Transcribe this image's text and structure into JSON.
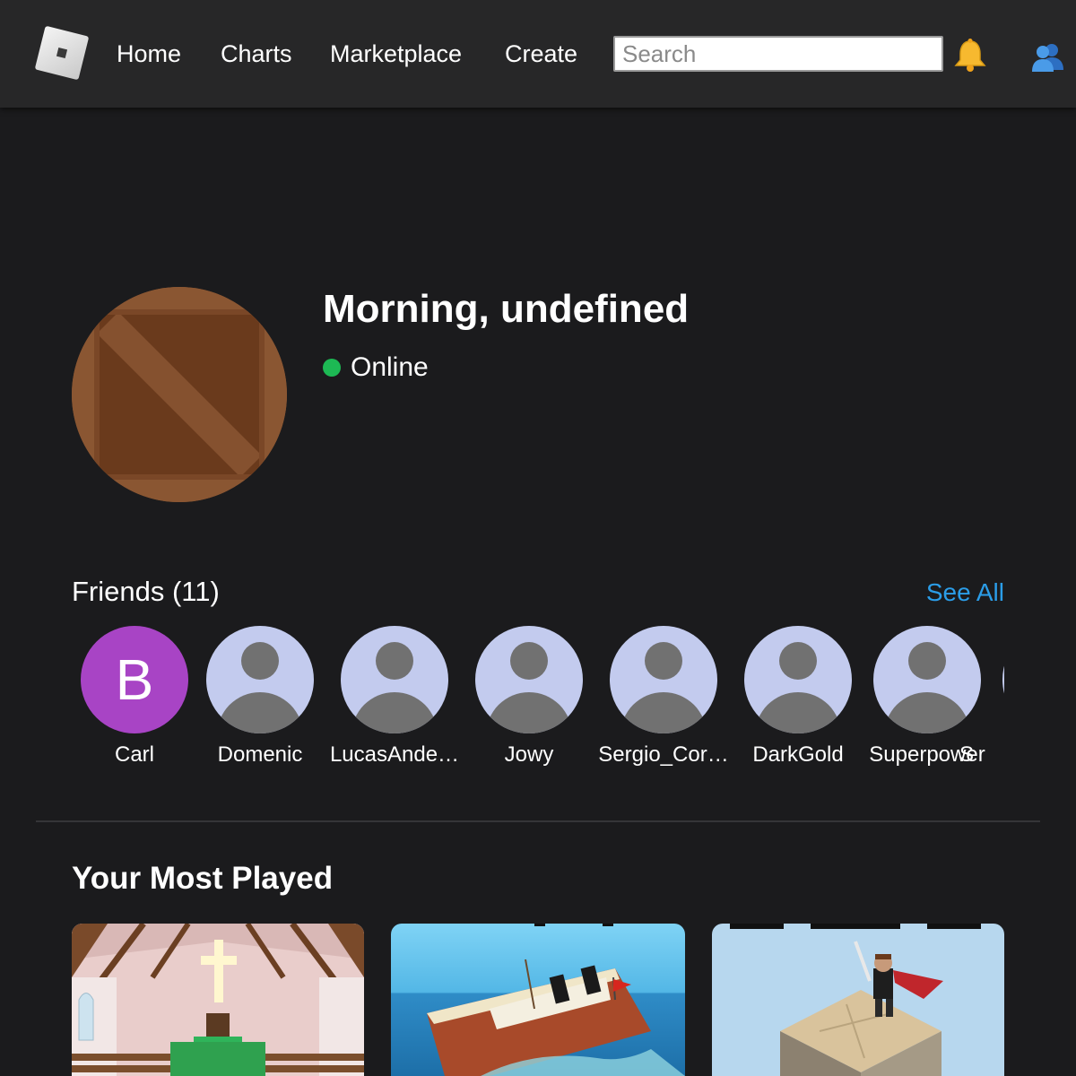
{
  "nav": {
    "items": [
      "Home",
      "Charts",
      "Marketplace",
      "Create"
    ],
    "search_placeholder": "Search",
    "icons": [
      "roblox-logo-icon",
      "bell-icon",
      "friends-icon"
    ]
  },
  "profile": {
    "greeting": "Morning, undefined",
    "status": "Online",
    "status_color": "#1db954"
  },
  "friends": {
    "title": "Friends (11)",
    "see_all": "See All",
    "list": [
      {
        "name": "Carl",
        "initial": "B"
      },
      {
        "name": "Domenic"
      },
      {
        "name": "LucasAnde…"
      },
      {
        "name": "Jowy"
      },
      {
        "name": "Sergio_Cor…"
      },
      {
        "name": "DarkGold"
      },
      {
        "name": "Superpower"
      },
      {
        "name": "S"
      }
    ]
  },
  "most_played": {
    "title": "Your Most Played"
  },
  "colors": {
    "background": "#1b1b1d",
    "topbar": "#272728",
    "link": "#2b9de8",
    "initial_avatar": "#a844c5",
    "default_avatar": "#c3cbee"
  }
}
